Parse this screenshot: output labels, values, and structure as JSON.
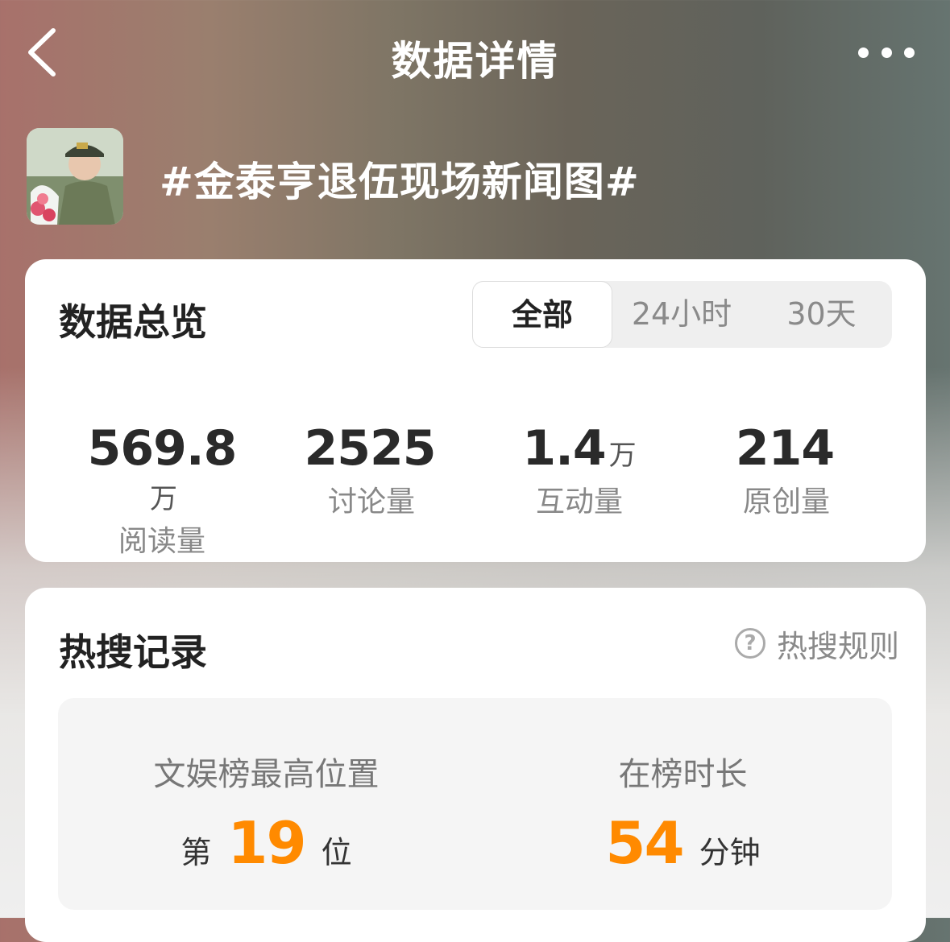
{
  "header": {
    "title": "数据详情",
    "back_icon": "chevron-left-icon",
    "more_icon": "more-dots-icon"
  },
  "topic": {
    "title": "#金泰亨退伍现场新闻图#",
    "avatar": "topic-avatar-photo"
  },
  "overview": {
    "title": "数据总览",
    "tabs": [
      {
        "label": "全部",
        "selected": true
      },
      {
        "label": "24小时",
        "selected": false
      },
      {
        "label": "30天",
        "selected": false
      }
    ],
    "stats": [
      {
        "value": "569.8",
        "unit": "万",
        "label": "阅读量"
      },
      {
        "value": "2525",
        "unit": "",
        "label": "讨论量"
      },
      {
        "value": "1.4",
        "unit": "万",
        "label": "互动量"
      },
      {
        "value": "214",
        "unit": "",
        "label": "原创量"
      }
    ]
  },
  "hot_search": {
    "title": "热搜记录",
    "rules_label": "热搜规则",
    "rules_icon": "question-circle-icon",
    "best_rank": {
      "label": "文娱榜最高位置",
      "prefix": "第",
      "value": "19",
      "suffix": "位"
    },
    "duration": {
      "label": "在榜时长",
      "value": "54",
      "suffix": "分钟"
    }
  },
  "colors": {
    "accent_orange": "#ff8a00",
    "card_bg": "#ffffff",
    "record_bg": "#f5f5f5"
  }
}
